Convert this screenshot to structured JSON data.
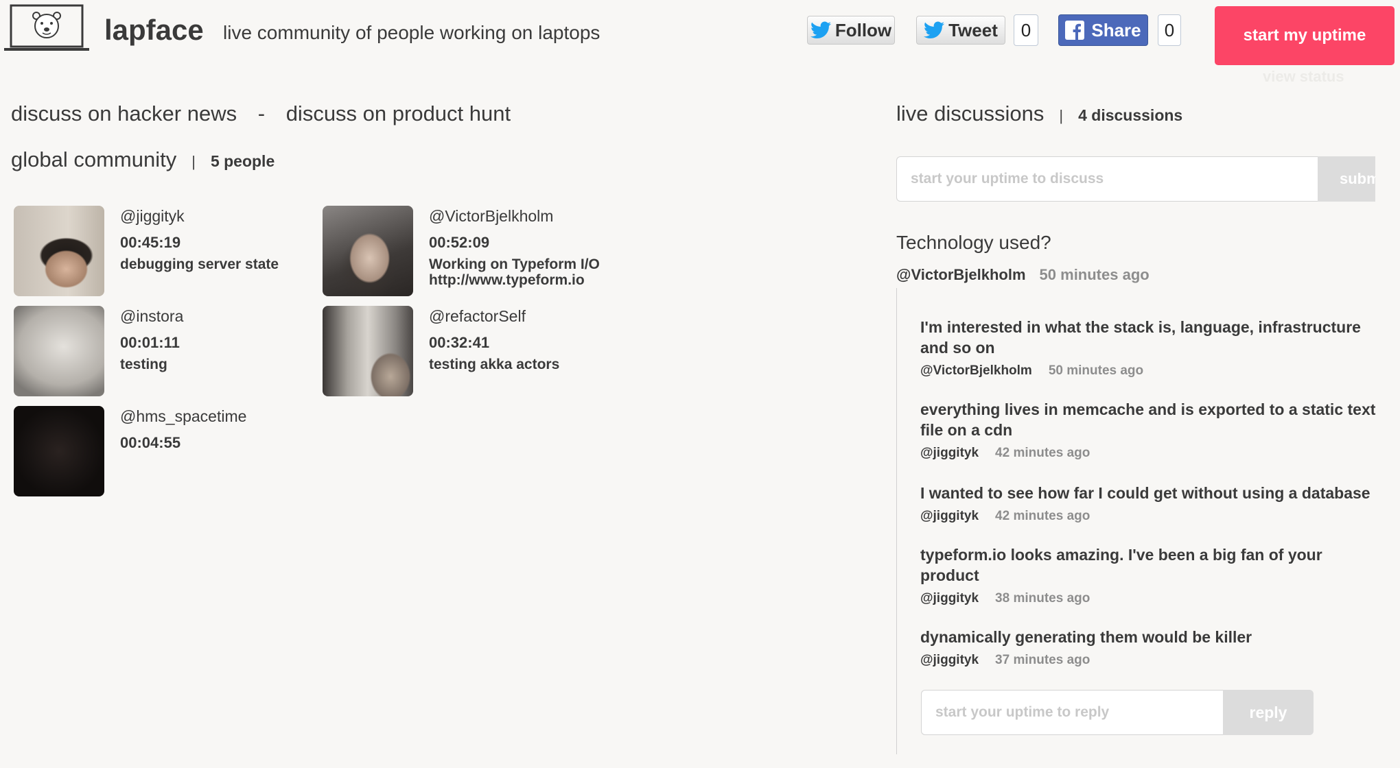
{
  "header": {
    "brand": "lapface",
    "tagline": "live community of people working on laptops",
    "follow_label": "Follow",
    "tweet_label": "Tweet",
    "tweet_count": "0",
    "share_label": "Share",
    "share_count": "0",
    "start_label": "start my uptime",
    "view_status_label": "view status"
  },
  "left": {
    "hn_link": "discuss on hacker news",
    "separator": "-",
    "ph_link": "discuss on product hunt",
    "community_title": "global community",
    "divider": "|",
    "people_count": "5 people",
    "people": [
      {
        "handle": "@jiggityk",
        "time": "00:45:19",
        "status": "debugging server state"
      },
      {
        "handle": "@VictorBjelkholm",
        "time": "00:52:09",
        "status": "Working on Typeform I/O http://www.typeform.io"
      },
      {
        "handle": "@instora",
        "time": "00:01:11",
        "status": "testing"
      },
      {
        "handle": "@refactorSelf",
        "time": "00:32:41",
        "status": "testing akka actors"
      },
      {
        "handle": "@hms_spacetime",
        "time": "00:04:55",
        "status": ""
      }
    ]
  },
  "right": {
    "title": "live discussions",
    "divider": "|",
    "count": "4 discussions",
    "input_placeholder": "start your uptime to discuss",
    "submit_label": "submit",
    "topic": {
      "title": "Technology used?",
      "author": "@VictorBjelkholm",
      "ago": "50 minutes ago"
    },
    "comments": [
      {
        "text": "I'm interested in what the stack is, language, infrastructure and so on",
        "author": "@VictorBjelkholm",
        "ago": "50 minutes ago"
      },
      {
        "text": "everything lives in memcache and is exported to a static text file on a cdn",
        "author": "@jiggityk",
        "ago": "42 minutes ago"
      },
      {
        "text": "I wanted to see how far I could get without using a database",
        "author": "@jiggityk",
        "ago": "42 minutes ago"
      },
      {
        "text": "typeform.io looks amazing. I've been a big fan of your product",
        "author": "@jiggityk",
        "ago": "38 minutes ago"
      },
      {
        "text": "dynamically generating them would be killer",
        "author": "@jiggityk",
        "ago": "37 minutes ago"
      }
    ],
    "reply_placeholder": "start your uptime to reply",
    "reply_label": "reply"
  },
  "colors": {
    "accent": "#fc4566",
    "facebook": "#4c69ba",
    "twitter": "#1da1f2",
    "background": "#f8f7f5"
  }
}
